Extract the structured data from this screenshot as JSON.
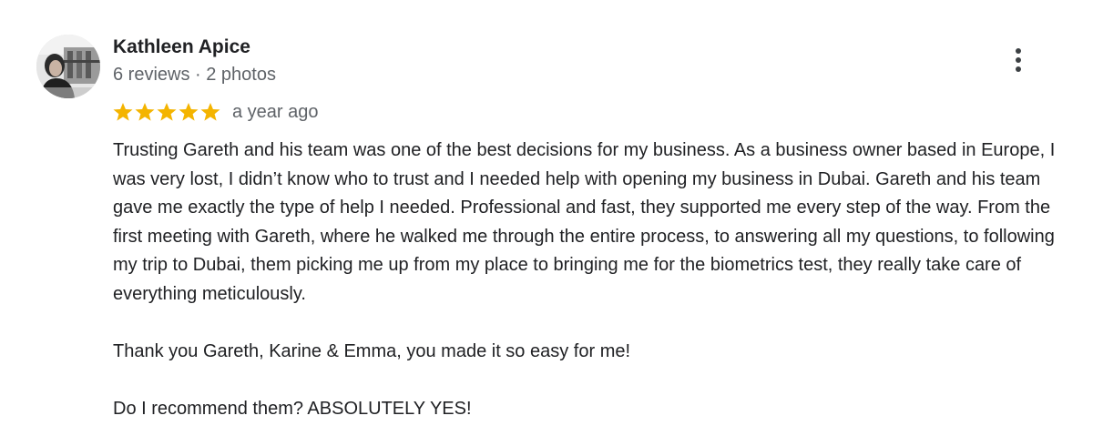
{
  "review": {
    "author": {
      "name": "Kathleen Apice",
      "meta": "6 reviews · 2 photos",
      "avatar_icon": "profile-photo"
    },
    "rating": {
      "stars": 5,
      "max_stars": 5,
      "star_color": "#F4B400",
      "date": "a year ago"
    },
    "more_icon": "more-vertical-icon",
    "body": {
      "paragraph_1": "Trusting Gareth and his team was one of the best decisions for my business. As a business owner based in Europe, I was very lost, I didn’t know who to trust and I needed help with opening my business in Dubai. Gareth and his team gave me exactly the type of help I needed. Professional and fast, they supported me every step of the way. From the first meeting with Gareth, where he walked me through the entire process, to answering all my questions, to following my trip to Dubai, them picking me up from my place to bringing me for the biometrics test, they really take care of everything meticulously.",
      "paragraph_2": "Thank you Gareth, Karine & Emma, you made it so easy for me!",
      "paragraph_3": "Do I recommend them? ABSOLUTELY YES!"
    }
  }
}
